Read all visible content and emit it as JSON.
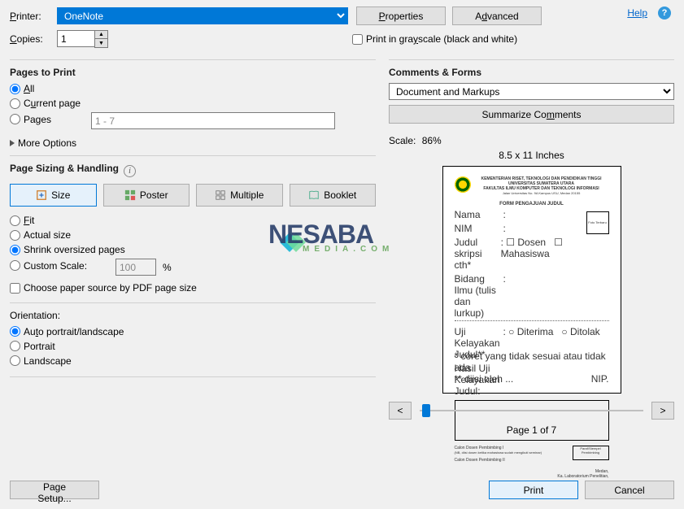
{
  "header": {
    "printer_label": "Printer:",
    "printer_value": "OneNote",
    "copies_label": "Copies:",
    "copies_value": "1",
    "properties_btn": "Properties",
    "advanced_btn": "Advanced",
    "help_link": "Help",
    "grayscale_label": "Print in grayscale (black and white)"
  },
  "pages_to_print": {
    "title": "Pages to Print",
    "all": "All",
    "current": "Current page",
    "pages": "Pages",
    "pages_range": "1 - 7",
    "more_options": "More Options"
  },
  "sizing": {
    "title": "Page Sizing & Handling",
    "size_btn": "Size",
    "poster_btn": "Poster",
    "multiple_btn": "Multiple",
    "booklet_btn": "Booklet",
    "fit": "Fit",
    "actual": "Actual size",
    "shrink": "Shrink oversized pages",
    "custom": "Custom Scale:",
    "custom_value": "100",
    "custom_pct": "%",
    "choose_paper": "Choose paper source by PDF page size"
  },
  "orientation": {
    "title": "Orientation:",
    "auto": "Auto portrait/landscape",
    "portrait": "Portrait",
    "landscape": "Landscape"
  },
  "comments": {
    "title": "Comments & Forms",
    "dropdown_value": "Document and Markups",
    "summarize_btn": "Summarize Comments"
  },
  "preview": {
    "scale_label": "Scale:",
    "scale_value": "86%",
    "dimensions": "8.5 x 11 Inches",
    "page_indicator": "Page 1 of 7",
    "prev": "<",
    "next": ">"
  },
  "footer": {
    "page_setup": "Page Setup...",
    "print": "Print",
    "cancel": "Cancel"
  }
}
